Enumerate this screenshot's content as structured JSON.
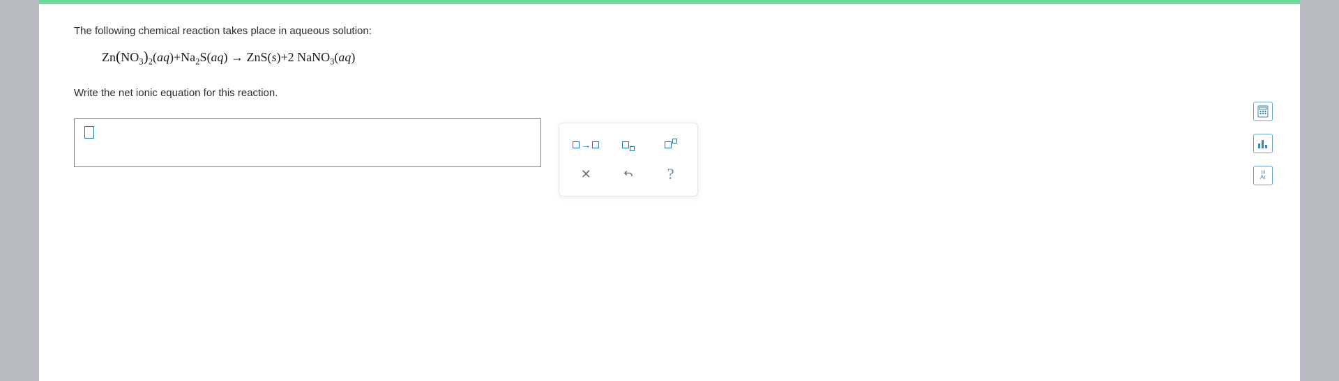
{
  "question": {
    "prompt": "The following chemical reaction takes place in aqueous solution:",
    "equation_html": "Zn<span class='big-paren'>(</span>NO<sub>3</sub><span class='big-paren'>)</span><sub>2</sub>(<i>aq</i>)+Na<sub>2</sub>S(<i>aq</i>) → ZnS(<i>s</i>)+2 NaNO<sub>3</sub>(<i>aq</i>)",
    "instruction": "Write the net ionic equation for this reaction."
  },
  "answer": {
    "value": ""
  },
  "toolbox": {
    "arrow_label": "reaction-arrow",
    "subscript_label": "subscript",
    "superscript_label": "superscript",
    "clear_label": "clear",
    "undo_label": "undo",
    "help_label": "?"
  },
  "side_tools": {
    "calc": "calculator",
    "stats": "data",
    "ptable": "Ar"
  }
}
